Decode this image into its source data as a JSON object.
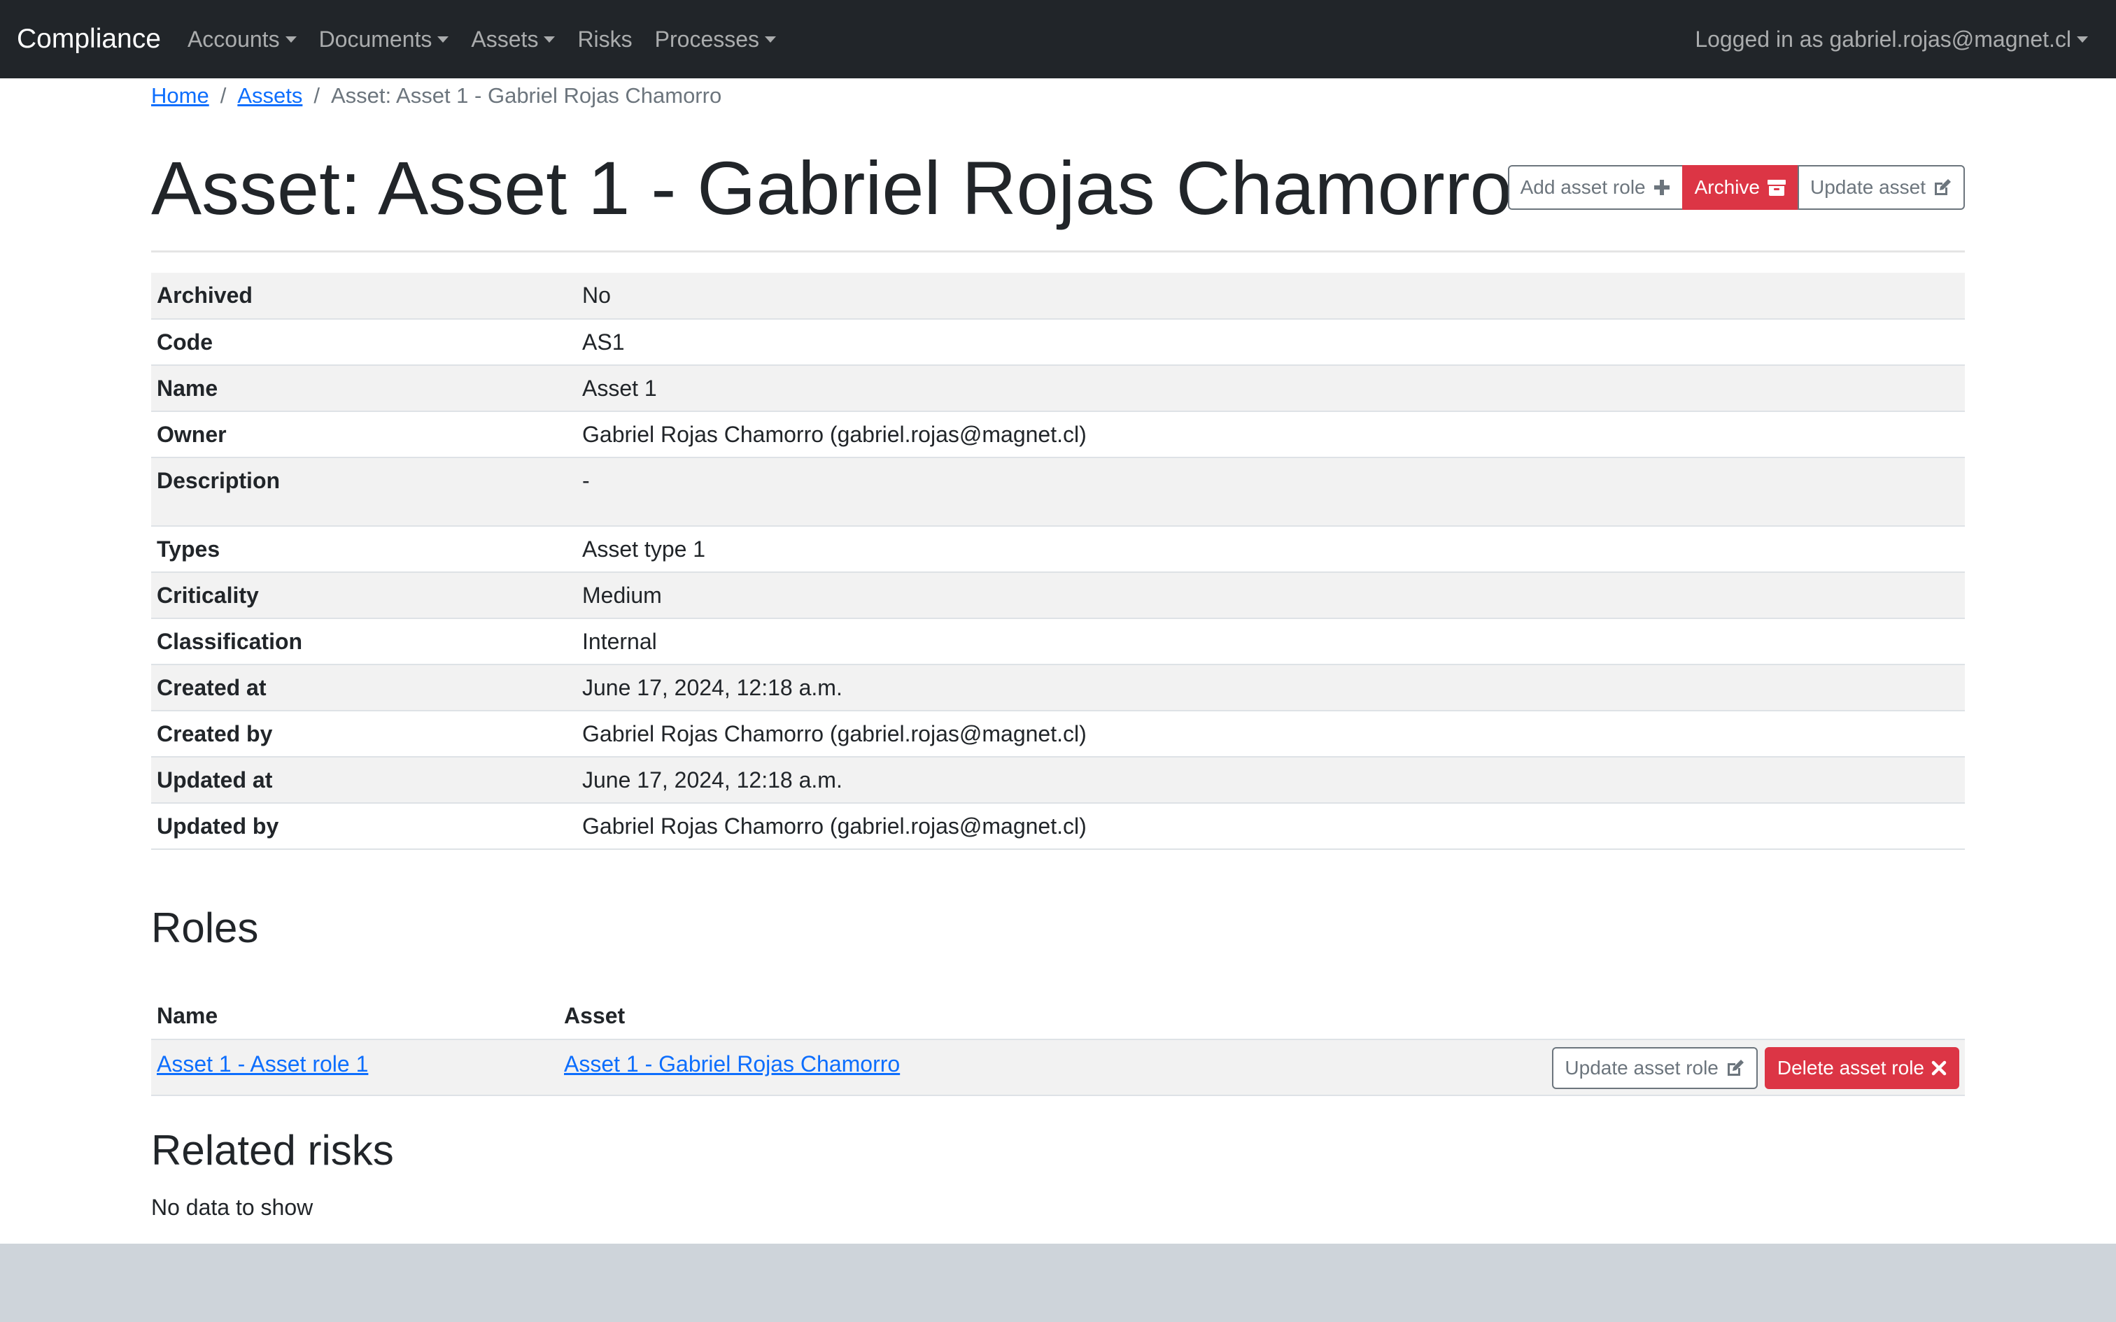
{
  "navbar": {
    "brand": "Compliance",
    "items": [
      {
        "label": "Accounts",
        "dropdown": true
      },
      {
        "label": "Documents",
        "dropdown": true
      },
      {
        "label": "Assets",
        "dropdown": true
      },
      {
        "label": "Risks",
        "dropdown": false
      },
      {
        "label": "Processes",
        "dropdown": true
      }
    ],
    "user_menu": "Logged in as gabriel.rojas@magnet.cl"
  },
  "breadcrumb": {
    "home": "Home",
    "assets": "Assets",
    "current": "Asset: Asset 1 - Gabriel Rojas Chamorro"
  },
  "page_title": "Asset: Asset 1 - Gabriel Rojas Chamorro",
  "actions": {
    "add_role": "Add asset role",
    "archive": "Archive",
    "update": "Update asset"
  },
  "details": [
    {
      "label": "Archived",
      "value": "No"
    },
    {
      "label": "Code",
      "value": "AS1"
    },
    {
      "label": "Name",
      "value": "Asset 1"
    },
    {
      "label": "Owner",
      "value": "Gabriel Rojas Chamorro (gabriel.rojas@magnet.cl)"
    },
    {
      "label": "Description",
      "value": "-"
    },
    {
      "label": "Types",
      "value": "Asset type 1"
    },
    {
      "label": "Criticality",
      "value": "Medium"
    },
    {
      "label": "Classification",
      "value": "Internal"
    },
    {
      "label": "Created at",
      "value": "June 17, 2024, 12:18 a.m."
    },
    {
      "label": "Created by",
      "value": "Gabriel Rojas Chamorro (gabriel.rojas@magnet.cl)"
    },
    {
      "label": "Updated at",
      "value": "June 17, 2024, 12:18 a.m."
    },
    {
      "label": "Updated by",
      "value": "Gabriel Rojas Chamorro (gabriel.rojas@magnet.cl)"
    }
  ],
  "roles": {
    "heading": "Roles",
    "columns": [
      "Name",
      "Asset"
    ],
    "rows": [
      {
        "name": "Asset 1 - Asset role 1",
        "asset": "Asset 1 - Gabriel Rojas Chamorro",
        "update_label": "Update asset role",
        "delete_label": "Delete asset role"
      }
    ]
  },
  "related_risks": {
    "heading": "Related risks",
    "empty_text": "No data to show"
  },
  "colors": {
    "navbar_bg": "#212529",
    "danger": "#dc3545",
    "link": "#0d6efd",
    "footer_bg": "#ced4da"
  }
}
